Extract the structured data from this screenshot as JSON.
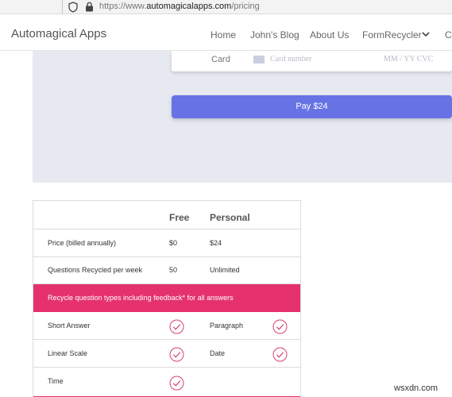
{
  "browser": {
    "url_prefix": "https://www.",
    "url_domain": "automagicalapps.com",
    "url_path": "/pricing"
  },
  "nav": {
    "brand": "Automagical Apps",
    "links": [
      "Home",
      "John's Blog",
      "About Us",
      "FormRecycler",
      "Co"
    ]
  },
  "payment": {
    "card_label": "Card",
    "card_placeholder": "Card number",
    "expiry_placeholder": "MM / YY  CVC",
    "pay_label": "Pay $24",
    "button_color": "#6772e5"
  },
  "pricing": {
    "headers": [
      "",
      "Free",
      "Personal"
    ],
    "rows": [
      {
        "label": "Price (billed annually)",
        "free": "$0",
        "personal": "$24"
      },
      {
        "label": "Questions Recycled per week",
        "free": "50",
        "personal": "Unlimited"
      }
    ],
    "highlight": "Recycle question types including feedback* for all answers",
    "highlight_color": "#e5326f",
    "features": [
      {
        "left": "Short Answer",
        "right": "Paragraph"
      },
      {
        "left": "Linear Scale",
        "right": "Date"
      },
      {
        "left": "Time",
        "right": ""
      }
    ]
  },
  "watermark": "wsxdn.com"
}
